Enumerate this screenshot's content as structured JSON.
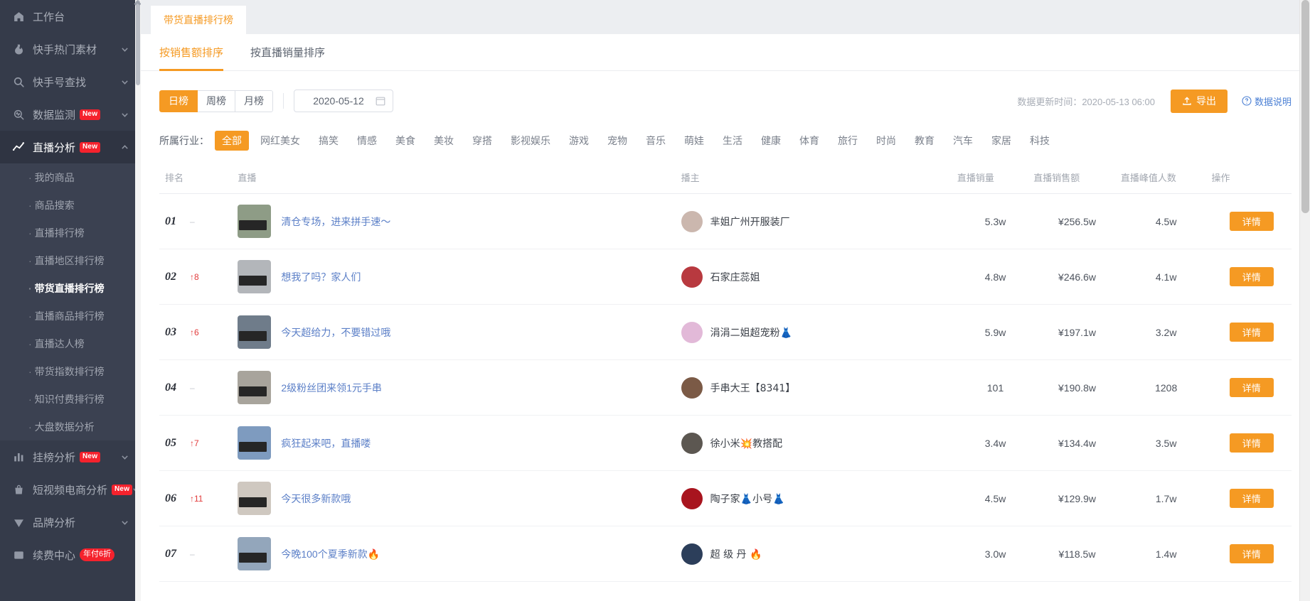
{
  "sidebar": {
    "items": [
      {
        "label": "工作台",
        "icon": "home-icon",
        "expandable": false,
        "badge": null
      },
      {
        "label": "快手热门素材",
        "icon": "fire-icon",
        "expandable": true,
        "badge": null
      },
      {
        "label": "快手号查找",
        "icon": "search-icon",
        "expandable": true,
        "badge": null
      },
      {
        "label": "数据监测",
        "icon": "monitor-icon",
        "expandable": true,
        "badge": "New"
      },
      {
        "label": "直播分析",
        "icon": "chart-line-icon",
        "expandable": true,
        "badge": "New",
        "expanded": true
      }
    ],
    "sub_items": [
      {
        "label": "我的商品",
        "active": false
      },
      {
        "label": "商品搜索",
        "active": false
      },
      {
        "label": "直播排行榜",
        "active": false
      },
      {
        "label": "直播地区排行榜",
        "active": false
      },
      {
        "label": "带货直播排行榜",
        "active": true
      },
      {
        "label": "直播商品排行榜",
        "active": false
      },
      {
        "label": "直播达人榜",
        "active": false
      },
      {
        "label": "带货指数排行榜",
        "active": false
      },
      {
        "label": "知识付费排行榜",
        "active": false
      },
      {
        "label": "大盘数据分析",
        "active": false
      }
    ],
    "bottom_items": [
      {
        "label": "挂榜分析",
        "icon": "bar-chart-icon",
        "expandable": true,
        "badge": "New"
      },
      {
        "label": "短视频电商分析",
        "icon": "bag-icon",
        "expandable": true,
        "badge": "New"
      },
      {
        "label": "品牌分析",
        "icon": "diamond-icon",
        "expandable": true,
        "badge": null
      },
      {
        "label": "续费中心",
        "icon": "card-icon",
        "expandable": false,
        "promo": "年付6折"
      }
    ]
  },
  "tab_chip": {
    "label": "带货直播排行榜"
  },
  "subtabs": [
    {
      "label": "按销售额排序",
      "active": true
    },
    {
      "label": "按直播销量排序",
      "active": false
    }
  ],
  "filters": {
    "period_options": [
      {
        "label": "日榜",
        "active": true
      },
      {
        "label": "周榜",
        "active": false
      },
      {
        "label": "月榜",
        "active": false
      }
    ],
    "date_value": "2020-05-12",
    "update_time": "数据更新时间：2020-05-13 06:00",
    "export_label": "导出",
    "help_label": "数据说明"
  },
  "industry": {
    "label": "所属行业：",
    "options": [
      {
        "label": "全部",
        "active": true
      },
      {
        "label": "网红美女",
        "active": false
      },
      {
        "label": "搞笑",
        "active": false
      },
      {
        "label": "情感",
        "active": false
      },
      {
        "label": "美食",
        "active": false
      },
      {
        "label": "美妆",
        "active": false
      },
      {
        "label": "穿搭",
        "active": false
      },
      {
        "label": "影视娱乐",
        "active": false
      },
      {
        "label": "游戏",
        "active": false
      },
      {
        "label": "宠物",
        "active": false
      },
      {
        "label": "音乐",
        "active": false
      },
      {
        "label": "萌娃",
        "active": false
      },
      {
        "label": "生活",
        "active": false
      },
      {
        "label": "健康",
        "active": false
      },
      {
        "label": "体育",
        "active": false
      },
      {
        "label": "旅行",
        "active": false
      },
      {
        "label": "时尚",
        "active": false
      },
      {
        "label": "教育",
        "active": false
      },
      {
        "label": "汽车",
        "active": false
      },
      {
        "label": "家居",
        "active": false
      },
      {
        "label": "科技",
        "active": false
      }
    ]
  },
  "table": {
    "columns": [
      "排名",
      "直播",
      "播主",
      "直播销量",
      "直播销售额",
      "直播峰值人数",
      "操作"
    ],
    "action_label": "详情",
    "rows": [
      {
        "rank": "01",
        "delta": "–",
        "delta_type": "flat",
        "live_title": "清仓专场，进来拼手速～",
        "host": "芈姐广州开服装厂",
        "sales": "5.3w",
        "amount": "¥256.5w",
        "peak": "4.5w",
        "thumb_color": "#8e9c86",
        "avatar_color": "#cbb7ae"
      },
      {
        "rank": "02",
        "delta": "↑8",
        "delta_type": "up",
        "live_title": "想我了吗？家人们",
        "host": "石家庄蕊姐",
        "sales": "4.8w",
        "amount": "¥246.6w",
        "peak": "4.1w",
        "thumb_color": "#b3b6ba",
        "avatar_color": "#b8393f"
      },
      {
        "rank": "03",
        "delta": "↑6",
        "delta_type": "up",
        "live_title": "今天超给力，不要错过哦",
        "host": "涓涓二姐超宠粉👗",
        "sales": "5.9w",
        "amount": "¥197.1w",
        "peak": "3.2w",
        "thumb_color": "#6f7c8a",
        "avatar_color": "#e2b9d8"
      },
      {
        "rank": "04",
        "delta": "–",
        "delta_type": "flat",
        "live_title": "2级粉丝团来领1元手串",
        "host": "手串大王【8341】",
        "sales": "101",
        "amount": "¥190.8w",
        "peak": "1208",
        "thumb_color": "#a8a49c",
        "avatar_color": "#7b5a46"
      },
      {
        "rank": "05",
        "delta": "↑7",
        "delta_type": "up",
        "live_title": "疯狂起来吧，直播喽",
        "host": "徐小米💥教搭配",
        "sales": "3.4w",
        "amount": "¥134.4w",
        "peak": "3.5w",
        "thumb_color": "#7e9bbf",
        "avatar_color": "#5c5751"
      },
      {
        "rank": "06",
        "delta": "↑11",
        "delta_type": "up",
        "live_title": "今天很多新款哦",
        "host": "陶子家👗小号👗",
        "sales": "4.5w",
        "amount": "¥129.9w",
        "peak": "1.7w",
        "thumb_color": "#cfc8c0",
        "avatar_color": "#a8141e"
      },
      {
        "rank": "07",
        "delta": "–",
        "delta_type": "flat",
        "live_title": "今晚100个夏季新款🔥",
        "host": "超 级 丹 🔥",
        "sales": "3.0w",
        "amount": "¥118.5w",
        "peak": "1.4w",
        "thumb_color": "#93a6bb",
        "avatar_color": "#2c3e5a"
      }
    ]
  },
  "colors": {
    "accent": "#f59a23",
    "sidebar_bg": "#353b4a",
    "link": "#5b7fc7",
    "badge_red": "#f5222d"
  }
}
